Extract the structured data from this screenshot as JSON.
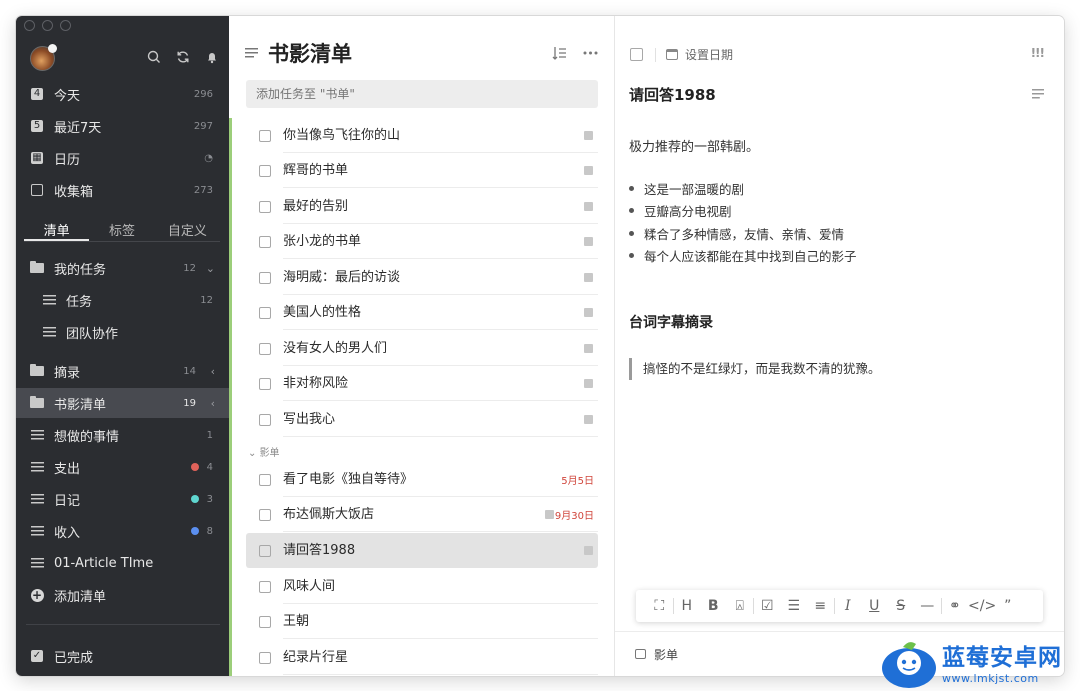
{
  "sidebar": {
    "smart_lists": [
      {
        "label": "今天",
        "count": "296",
        "icon": "calendar-day-icon"
      },
      {
        "label": "最近7天",
        "count": "297",
        "icon": "calendar-week-icon"
      },
      {
        "label": "日历",
        "count": "",
        "icon": "calendar-icon"
      },
      {
        "label": "收集箱",
        "count": "273",
        "icon": "inbox-icon"
      }
    ],
    "tabs": [
      "清单",
      "标签",
      "自定义"
    ],
    "lists": [
      {
        "label": "我的任务",
        "count": "12",
        "icon": "folder-icon"
      },
      {
        "label": "任务",
        "count": "12",
        "icon": "list-icon"
      },
      {
        "label": "团队协作",
        "count": "",
        "icon": "list-icon"
      },
      {
        "label": "摘录",
        "count": "14",
        "icon": "folder-icon"
      },
      {
        "label": "书影清单",
        "count": "19",
        "icon": "folder-icon"
      },
      {
        "label": "想做的事情",
        "count": "1",
        "icon": "list-icon"
      },
      {
        "label": "支出",
        "count": "4",
        "icon": "list-icon",
        "dot": "#e0625a"
      },
      {
        "label": "日记",
        "count": "3",
        "icon": "list-icon",
        "dot": "#5fd6d0"
      },
      {
        "label": "收入",
        "count": "8",
        "icon": "list-icon",
        "dot": "#5b8ff0"
      },
      {
        "label": "01-Article TIme",
        "count": "",
        "icon": "article-list-icon"
      }
    ],
    "add_list": "添加清单",
    "completed": "已完成"
  },
  "list_pane": {
    "title": "书影清单",
    "add_placeholder": "添加任务至 \"书单\"",
    "tasks": [
      "你当像鸟飞往你的山",
      "辉哥的书单",
      "最好的告别",
      "张小龙的书单",
      "海明威：最后的访谈",
      "美国人的性格",
      "没有女人的男人们",
      "非对称风险",
      "写出我心"
    ],
    "section": "影单",
    "section_tasks": [
      {
        "title": "看了电影《独自等待》",
        "date": "5月5日"
      },
      {
        "title": "布达佩斯大饭店",
        "date": "9月30日"
      },
      {
        "title": "请回答1988",
        "date": ""
      },
      {
        "title": "风味人间",
        "date": ""
      },
      {
        "title": "王朝",
        "date": ""
      },
      {
        "title": "纪录片行星",
        "date": ""
      }
    ]
  },
  "detail": {
    "set_date": "设置日期",
    "priority": "!!!",
    "title": "请回答1988",
    "description": "极力推荐的一部韩剧。",
    "bullets": [
      "这是一部温暖的剧",
      "豆瓣高分电视剧",
      "糅合了多种情感，友情、亲情、爱情",
      "每个人应该都能在其中找到自己的影子"
    ],
    "heading": "台词字幕摘录",
    "quote": "搞怪的不是红绿灯，而是我数不清的犹豫。",
    "toolbar": [
      "H",
      "B",
      "I",
      "U",
      "S"
    ],
    "list_name": "影单"
  },
  "watermark": {
    "title": "蓝莓安卓网",
    "url": "www.lmkjst.com"
  }
}
